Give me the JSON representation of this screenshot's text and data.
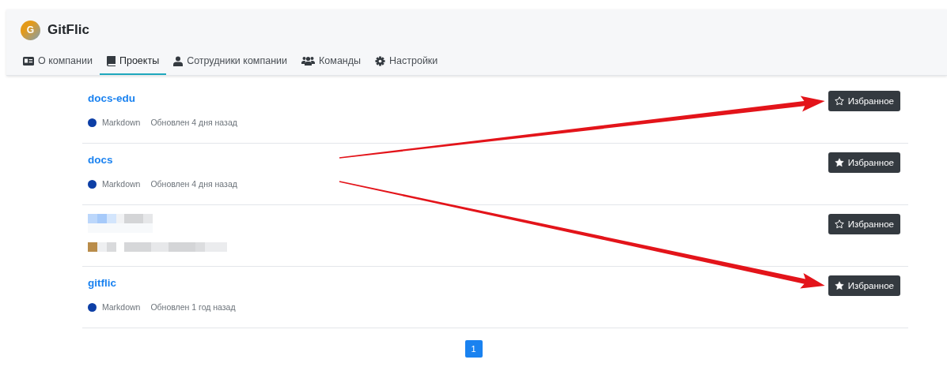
{
  "organization": {
    "initial": "G",
    "name": "GitFlic"
  },
  "tabs": [
    {
      "label": "О компании",
      "selected": false
    },
    {
      "label": "Проекты",
      "selected": true
    },
    {
      "label": "Сотрудники компании",
      "selected": false
    },
    {
      "label": "Команды",
      "selected": false
    },
    {
      "label": "Настройки",
      "selected": false
    }
  ],
  "projects": [
    {
      "kind": "project",
      "name": "docs-edu",
      "language": "Markdown",
      "color": "#0d3fa6",
      "updated": "Обновлен 4 дня назад",
      "favorite": false,
      "favorite_label": "Избранное",
      "arrow_target": true,
      "arrow_origin": false
    },
    {
      "kind": "project",
      "name": "docs",
      "language": "Markdown",
      "color": "#0d3fa6",
      "updated": "Обновлен 4 дня назад",
      "favorite": true,
      "favorite_label": "Избранное",
      "arrow_target": false,
      "arrow_origin": true
    },
    {
      "kind": "redacted",
      "favorite": false,
      "favorite_label": "Избранное",
      "arrow_target": false,
      "arrow_origin": false
    },
    {
      "kind": "project",
      "name": "gitflic",
      "language": "Markdown",
      "color": "#0d3fa6",
      "updated": "Обновлен 1 год назад",
      "favorite": true,
      "favorite_label": "Избранное",
      "arrow_target": true,
      "arrow_origin": false
    }
  ],
  "pagination": [
    {
      "label": "1",
      "selected": true
    }
  ]
}
